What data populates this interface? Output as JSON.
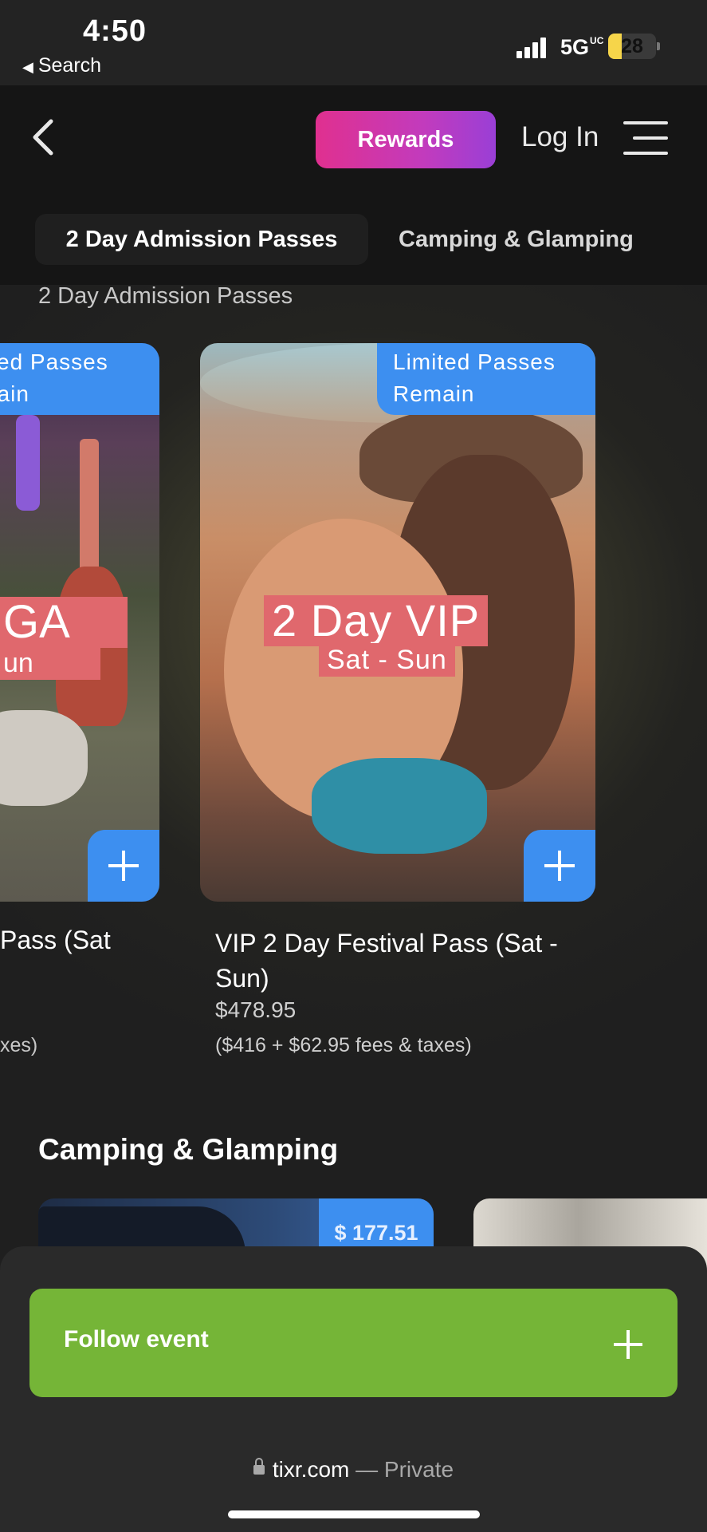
{
  "status_bar": {
    "time": "4:50",
    "back_app": "Search",
    "network": "5G",
    "network_suffix": "UC",
    "battery": "28",
    "battery_level": 0.28
  },
  "header": {
    "rewards_label": "Rewards",
    "login_label": "Log In",
    "tabs": [
      {
        "label": "2 Day Admission Passes",
        "active": true
      },
      {
        "label": "Camping & Glamping",
        "active": false
      }
    ]
  },
  "section1": {
    "title": "2 Day Admission Passes",
    "cards": [
      {
        "badge_line1": "ited Passes",
        "badge_line2": "nain",
        "overlay_big": "GA",
        "overlay_small": "un",
        "name": "Pass (Sat",
        "fees": "xes)"
      },
      {
        "badge_line1": "Limited Passes",
        "badge_line2": "Remain",
        "overlay_big": "2 Day VIP",
        "overlay_small": "Sat - Sun",
        "name": "VIP 2 Day Festival Pass (Sat - Sun)",
        "price": "$478.95",
        "fees": "($416 + $62.95 fees & taxes)"
      }
    ]
  },
  "section2": {
    "title": "Camping & Glamping",
    "first_price": "$ 177.51"
  },
  "bottom": {
    "follow_label": "Follow event",
    "url": "tixr.com",
    "url_suffix": "— Private"
  },
  "colors": {
    "accent_blue": "#3d8ff0",
    "follow_green": "#75b537",
    "rewards_pink": "#e0308f",
    "overlay_red": "#e0686d"
  }
}
